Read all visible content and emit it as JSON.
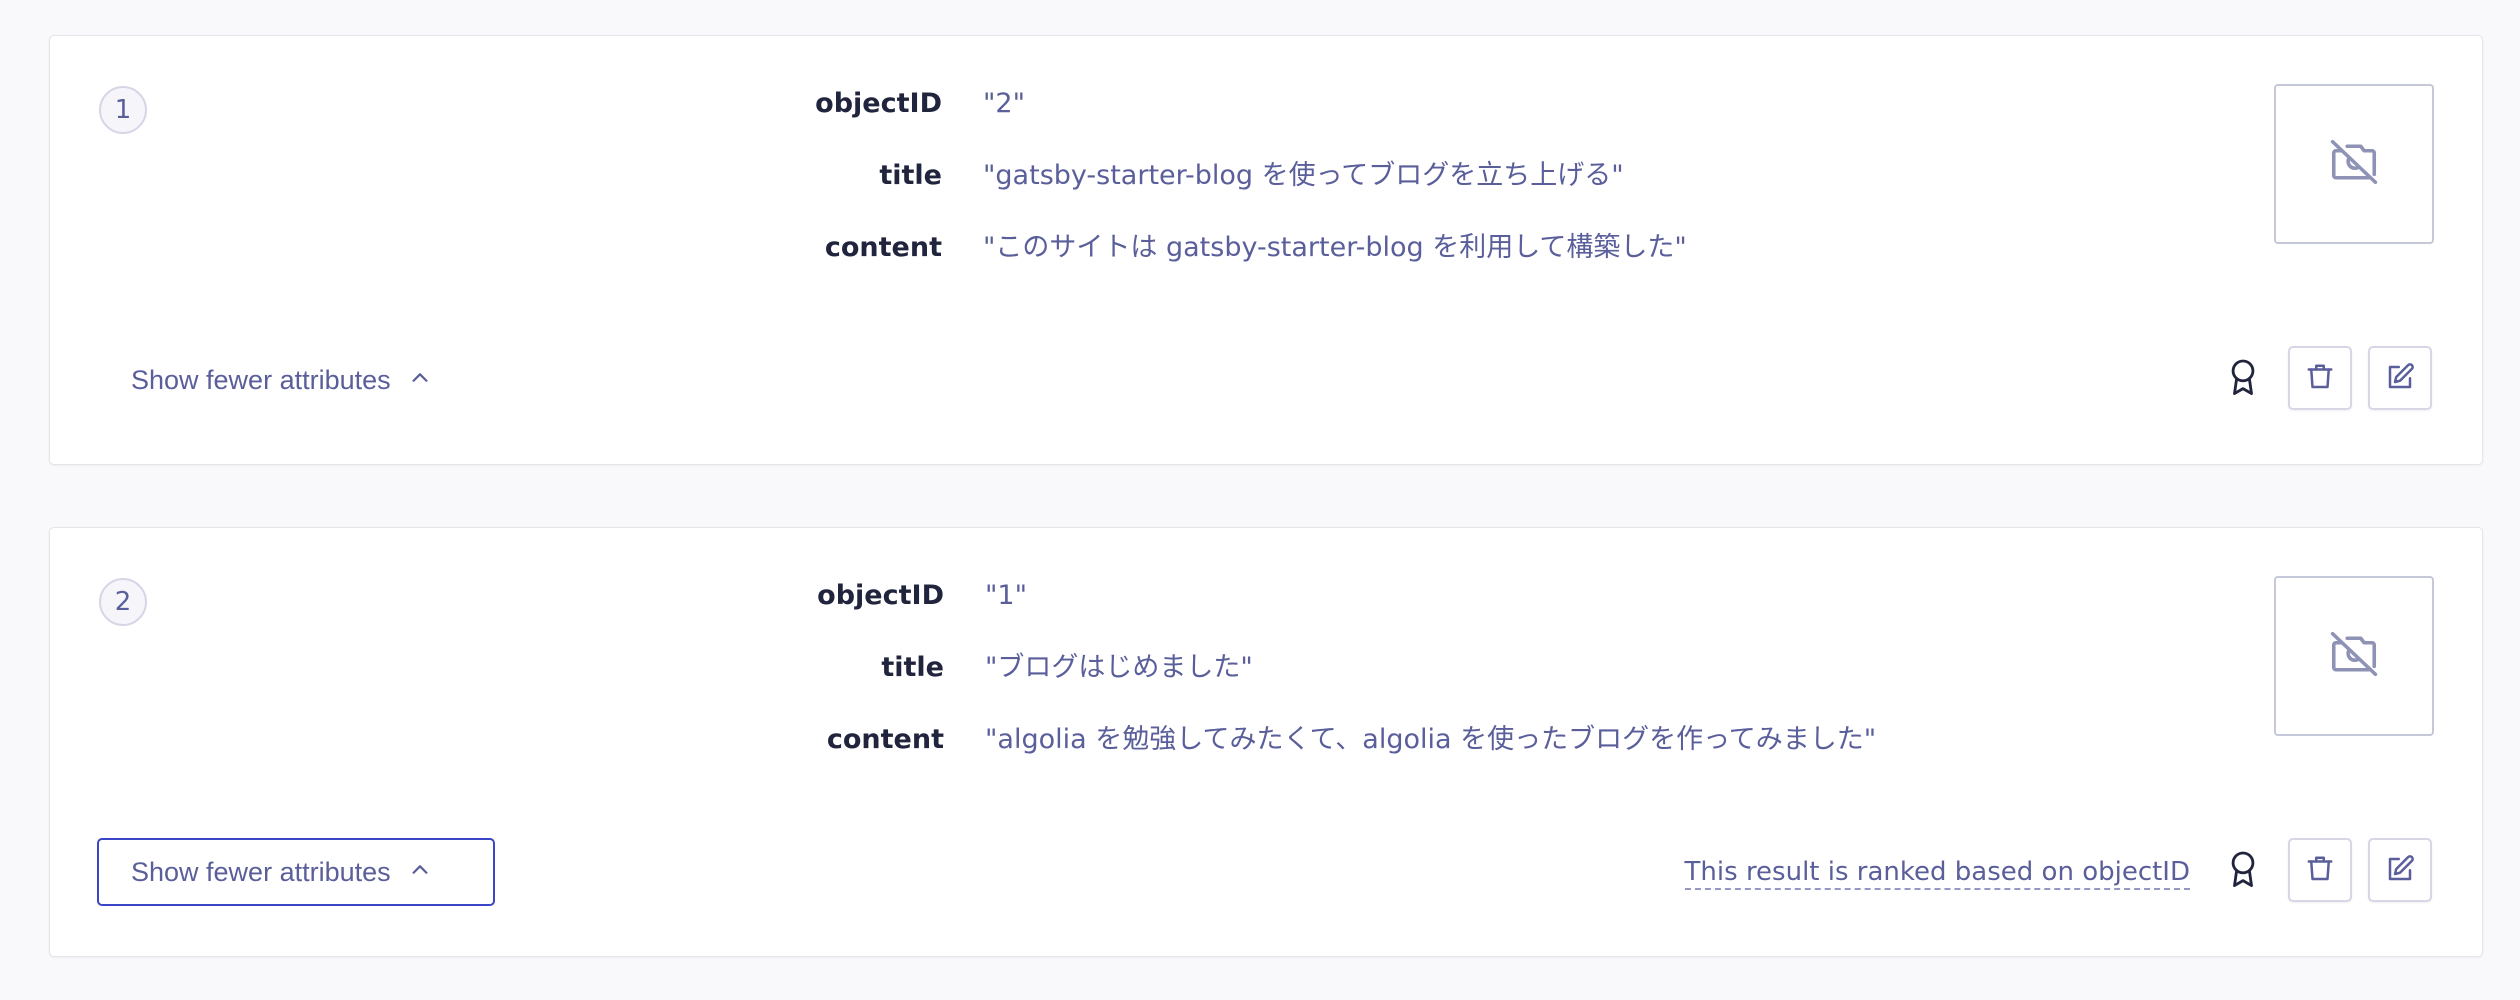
{
  "colors": {
    "accent": "#3a46c8",
    "text_muted": "#5a5e9a",
    "text_strong": "#21243d",
    "border": "#d6d6e7"
  },
  "records": [
    {
      "rank": "1",
      "attributes": [
        {
          "key": "objectID",
          "value": "\"2\""
        },
        {
          "key": "title",
          "value": "\"gatsby-starter-blog を使ってブログを立ち上げる\""
        },
        {
          "key": "content",
          "value": "\"このサイトは gatsby-starter-blog を利用して構築した\""
        }
      ],
      "toggle_label": "Show fewer attributes",
      "ranking_note": ""
    },
    {
      "rank": "2",
      "attributes": [
        {
          "key": "objectID",
          "value": "\"1\""
        },
        {
          "key": "title",
          "value": "\"ブログはじめました\""
        },
        {
          "key": "content",
          "value": "\"algolia を勉強してみたくて、algolia を使ったブログを作ってみました\""
        }
      ],
      "toggle_label": "Show fewer attributes",
      "ranking_note": "This result is ranked based on objectID"
    }
  ],
  "icons": {
    "thumbnail": "camera-off-icon",
    "ranking": "ribbon-icon",
    "delete": "trash-icon",
    "edit": "edit-icon",
    "toggle": "chevron-up-icon"
  }
}
